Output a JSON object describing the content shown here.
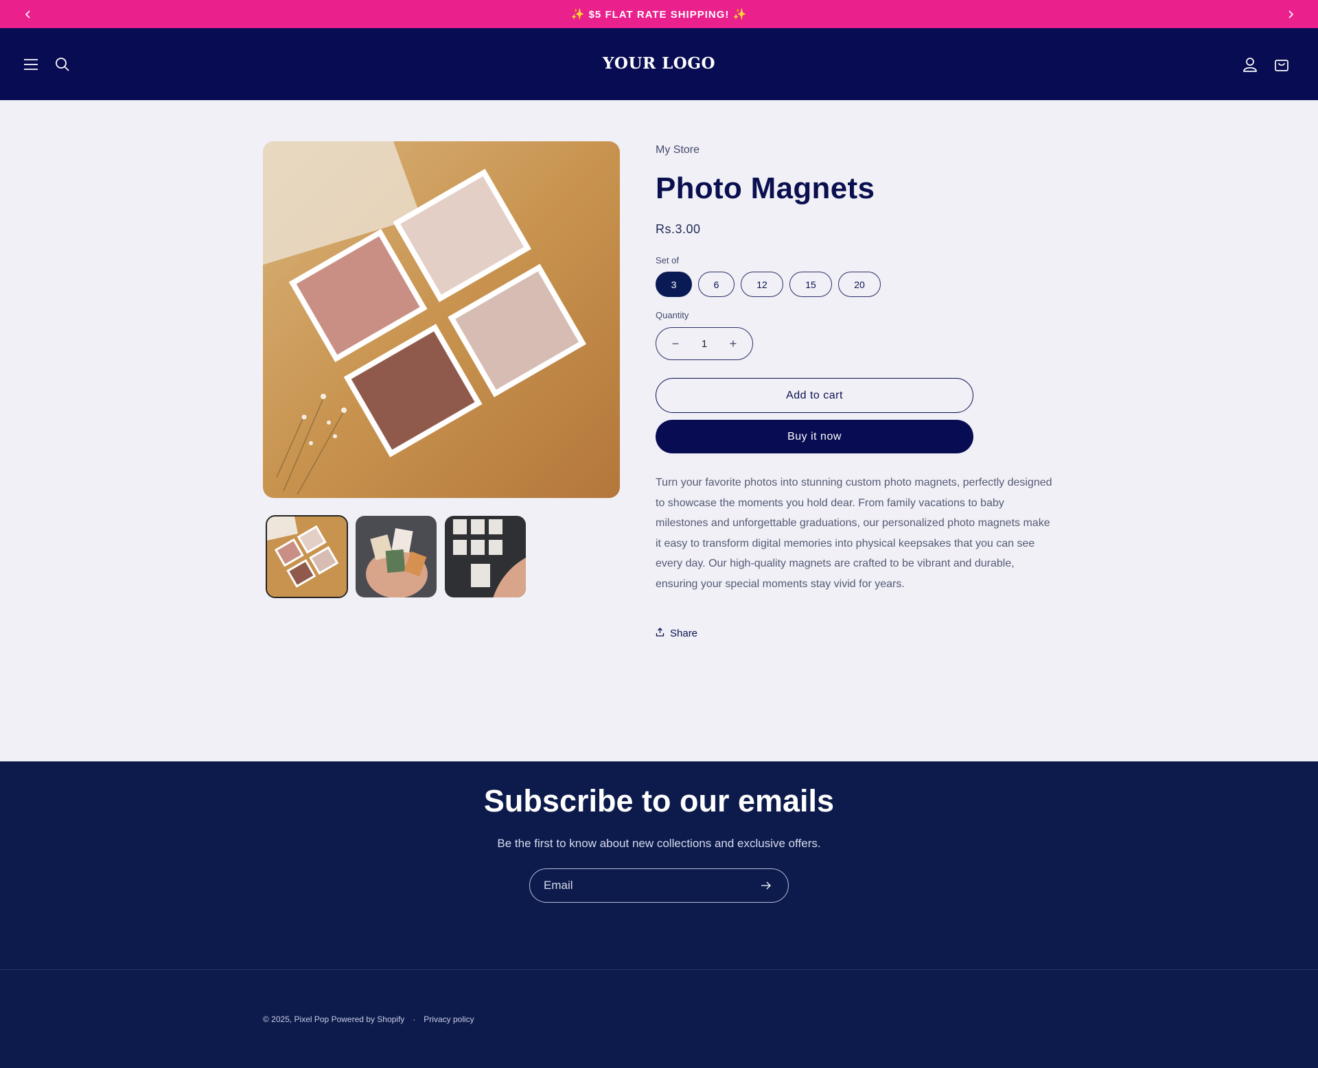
{
  "announcement": {
    "text": "$5 FLAT RATE SHIPPING!",
    "prev_icon": "chevron-left-icon",
    "next_icon": "chevron-right-icon",
    "star_icon": "sparkle-star-icon"
  },
  "header": {
    "logo": "YOUR LOGO",
    "icons": [
      "menu-icon",
      "search-icon",
      "account-icon",
      "cart-icon"
    ]
  },
  "product": {
    "vendor": "My Store",
    "title": "Photo Magnets",
    "price": "Rs.3.00",
    "option_label": "Set of",
    "options": [
      "3",
      "6",
      "12",
      "15",
      "20"
    ],
    "selected_option": "3",
    "quantity_label": "Quantity",
    "quantity": "1",
    "minus": "−",
    "plus": "+",
    "add_to_cart": "Add to cart",
    "buy_now": "Buy it now",
    "description": "Turn your favorite photos into stunning custom photo magnets, perfectly designed to showcase the moments you hold dear. From family vacations to baby milestones and unforgettable graduations, our personalized photo magnets make it easy to transform digital memories into physical keepsakes that you can see every day. Our high-quality magnets are crafted to be vibrant and durable, ensuring your special moments stay vivid for years.",
    "share": "Share"
  },
  "subscribe": {
    "title": "Subscribe to our emails",
    "text": "Be the first to know about new collections and exclusive offers.",
    "email_placeholder": "Email"
  },
  "footer": {
    "copyright": "© 2025, Pixel Pop Powered by Shopify",
    "separator": "·",
    "privacy": "Privacy policy"
  },
  "colors": {
    "announcement_bg": "#ea208c",
    "header_bg": "#080c52",
    "page_bg": "#f0f0f6",
    "footer_bg": "#0d1b4c"
  }
}
